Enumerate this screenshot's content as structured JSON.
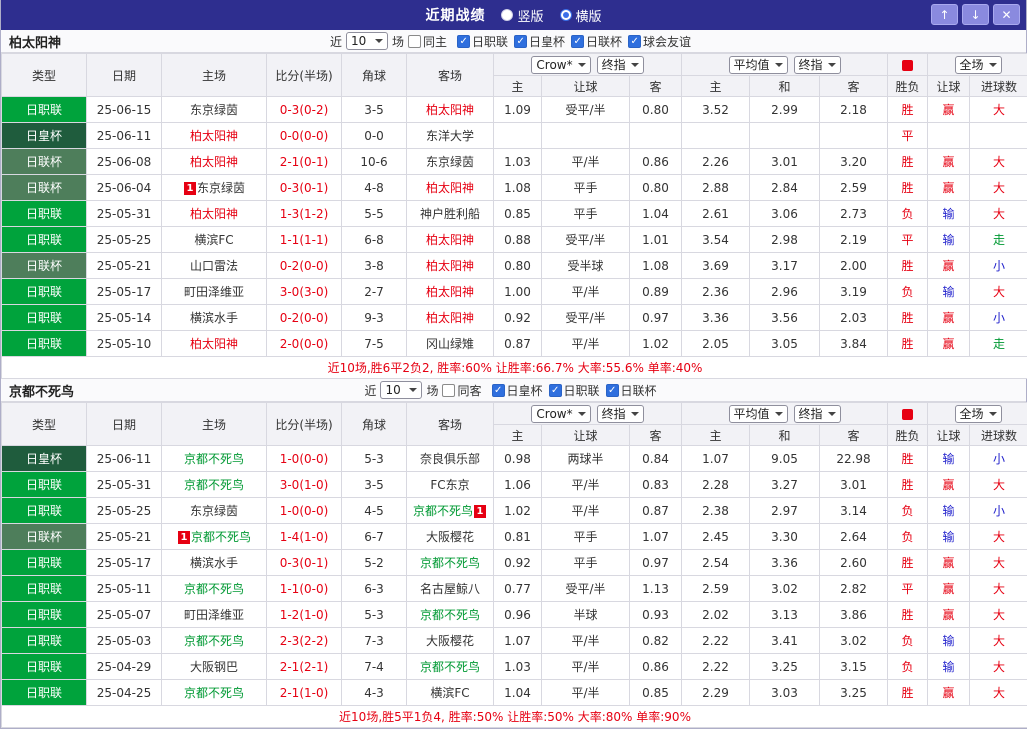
{
  "titlebar": {
    "title": "近期战绩",
    "options": [
      {
        "label": "竖版",
        "selected": false
      },
      {
        "label": "横版",
        "selected": true
      }
    ],
    "buttons": {
      "up": "↑",
      "down": "↓",
      "close": "✕"
    }
  },
  "labels": {
    "near": "近",
    "count": "10",
    "unit": "场"
  },
  "odds_controls": {
    "company": "Crow*",
    "final": "终指",
    "average": "平均值",
    "scope": "全场"
  },
  "table_header": {
    "type": "类型",
    "date": "日期",
    "home": "主场",
    "score": "比分(半场)",
    "corner": "角球",
    "away": "客场",
    "ah_home": "主",
    "ah_line": "让球",
    "ah_away": "客",
    "eu_home": "主",
    "eu_draw": "和",
    "eu_away": "客",
    "result": "胜负",
    "handicap_result": "让球",
    "goals": "进球数"
  },
  "type_colors": {
    "日职联": "#00a33c",
    "日皇杯": "#1f5c3d",
    "日联杯": "#4e7e5b"
  },
  "team_colors": {
    "red": "#e60012",
    "green": "#009933",
    "default": "#333333"
  },
  "palette": {
    "score": "#e60012"
  },
  "value_colors": {
    "胜": "#e60012",
    "平": "#e60012",
    "负": "#e60012",
    "赢": "#e60012",
    "输": "#2222cc",
    "大": "#e60012",
    "小": "#2222cc",
    "走": "#009933"
  },
  "sections": [
    {
      "team": "柏太阳神",
      "same_label": "同主",
      "same_checked": false,
      "competitions": [
        {
          "label": "日职联",
          "checked": true
        },
        {
          "label": "日皇杯",
          "checked": true
        },
        {
          "label": "日联杯",
          "checked": true
        },
        {
          "label": "球会友谊",
          "checked": true
        }
      ],
      "rows": [
        {
          "type": "日职联",
          "date": "25-06-15",
          "home": "东京绿茵",
          "home_color": "default",
          "home_card": "",
          "home_card_pos": "",
          "score": "0-3(0-2)",
          "corner": "3-5",
          "away": "柏太阳神",
          "away_color": "red",
          "away_card": "",
          "away_card_pos": "",
          "odds": [
            "1.09",
            "受平/半",
            "0.80",
            "3.52",
            "2.99",
            "2.18"
          ],
          "result": "胜",
          "rh": "赢",
          "goal": "大"
        },
        {
          "type": "日皇杯",
          "date": "25-06-11",
          "home": "柏太阳神",
          "home_color": "red",
          "home_card": "",
          "home_card_pos": "",
          "score": "0-0(0-0)",
          "corner": "0-0",
          "away": "东洋大学",
          "away_color": "default",
          "away_card": "",
          "away_card_pos": "",
          "odds": [
            "",
            "",
            "",
            "",
            "",
            ""
          ],
          "result": "平",
          "rh": "",
          "goal": ""
        },
        {
          "type": "日联杯",
          "date": "25-06-08",
          "home": "柏太阳神",
          "home_color": "red",
          "home_card": "",
          "home_card_pos": "",
          "score": "2-1(0-1)",
          "corner": "10-6",
          "away": "东京绿茵",
          "away_color": "default",
          "away_card": "",
          "away_card_pos": "",
          "odds": [
            "1.03",
            "平/半",
            "0.86",
            "2.26",
            "3.01",
            "3.20"
          ],
          "result": "胜",
          "rh": "赢",
          "goal": "大"
        },
        {
          "type": "日联杯",
          "date": "25-06-04",
          "home": "东京绿茵",
          "home_color": "default",
          "home_card": "1",
          "home_card_pos": "before",
          "score": "0-3(0-1)",
          "corner": "4-8",
          "away": "柏太阳神",
          "away_color": "red",
          "away_card": "",
          "away_card_pos": "",
          "odds": [
            "1.08",
            "平手",
            "0.80",
            "2.88",
            "2.84",
            "2.59"
          ],
          "result": "胜",
          "rh": "赢",
          "goal": "大"
        },
        {
          "type": "日职联",
          "date": "25-05-31",
          "home": "柏太阳神",
          "home_color": "red",
          "home_card": "",
          "home_card_pos": "",
          "score": "1-3(1-2)",
          "corner": "5-5",
          "away": "神户胜利船",
          "away_color": "default",
          "away_card": "",
          "away_card_pos": "",
          "odds": [
            "0.85",
            "平手",
            "1.04",
            "2.61",
            "3.06",
            "2.73"
          ],
          "result": "负",
          "rh": "输",
          "goal": "大"
        },
        {
          "type": "日职联",
          "date": "25-05-25",
          "home": "横滨FC",
          "home_color": "default",
          "home_card": "",
          "home_card_pos": "",
          "score": "1-1(1-1)",
          "corner": "6-8",
          "away": "柏太阳神",
          "away_color": "red",
          "away_card": "",
          "away_card_pos": "",
          "odds": [
            "0.88",
            "受平/半",
            "1.01",
            "3.54",
            "2.98",
            "2.19"
          ],
          "result": "平",
          "rh": "输",
          "goal": "走"
        },
        {
          "type": "日联杯",
          "date": "25-05-21",
          "home": "山口雷法",
          "home_color": "default",
          "home_card": "",
          "home_card_pos": "",
          "score": "0-2(0-0)",
          "corner": "3-8",
          "away": "柏太阳神",
          "away_color": "red",
          "away_card": "",
          "away_card_pos": "",
          "odds": [
            "0.80",
            "受半球",
            "1.08",
            "3.69",
            "3.17",
            "2.00"
          ],
          "result": "胜",
          "rh": "赢",
          "goal": "小"
        },
        {
          "type": "日职联",
          "date": "25-05-17",
          "home": "町田泽维亚",
          "home_color": "default",
          "home_card": "",
          "home_card_pos": "",
          "score": "3-0(3-0)",
          "corner": "2-7",
          "away": "柏太阳神",
          "away_color": "red",
          "away_card": "",
          "away_card_pos": "",
          "odds": [
            "1.00",
            "平/半",
            "0.89",
            "2.36",
            "2.96",
            "3.19"
          ],
          "result": "负",
          "rh": "输",
          "goal": "大"
        },
        {
          "type": "日职联",
          "date": "25-05-14",
          "home": "横滨水手",
          "home_color": "default",
          "home_card": "",
          "home_card_pos": "",
          "score": "0-2(0-0)",
          "corner": "9-3",
          "away": "柏太阳神",
          "away_color": "red",
          "away_card": "",
          "away_card_pos": "",
          "odds": [
            "0.92",
            "受平/半",
            "0.97",
            "3.36",
            "3.56",
            "2.03"
          ],
          "result": "胜",
          "rh": "赢",
          "goal": "小"
        },
        {
          "type": "日职联",
          "date": "25-05-10",
          "home": "柏太阳神",
          "home_color": "red",
          "home_card": "",
          "home_card_pos": "",
          "score": "2-0(0-0)",
          "corner": "7-5",
          "away": "冈山绿雉",
          "away_color": "default",
          "away_card": "",
          "away_card_pos": "",
          "odds": [
            "0.87",
            "平/半",
            "1.02",
            "2.05",
            "3.05",
            "3.84"
          ],
          "result": "胜",
          "rh": "赢",
          "goal": "走"
        }
      ],
      "summary": "近10场,胜6平2负2, 胜率:60% 让胜率:66.7% 大率:55.6% 单率:40%"
    },
    {
      "team": "京都不死鸟",
      "same_label": "同客",
      "same_checked": false,
      "competitions": [
        {
          "label": "日皇杯",
          "checked": true
        },
        {
          "label": "日职联",
          "checked": true
        },
        {
          "label": "日联杯",
          "checked": true
        }
      ],
      "rows": [
        {
          "type": "日皇杯",
          "date": "25-06-11",
          "home": "京都不死鸟",
          "home_color": "green",
          "home_card": "",
          "home_card_pos": "",
          "score": "1-0(0-0)",
          "corner": "5-3",
          "away": "奈良俱乐部",
          "away_color": "default",
          "away_card": "",
          "away_card_pos": "",
          "odds": [
            "0.98",
            "两球半",
            "0.84",
            "1.07",
            "9.05",
            "22.98"
          ],
          "result": "胜",
          "rh": "输",
          "goal": "小"
        },
        {
          "type": "日职联",
          "date": "25-05-31",
          "home": "京都不死鸟",
          "home_color": "green",
          "home_card": "",
          "home_card_pos": "",
          "score": "3-0(1-0)",
          "corner": "3-5",
          "away": "FC东京",
          "away_color": "default",
          "away_card": "",
          "away_card_pos": "",
          "odds": [
            "1.06",
            "平/半",
            "0.83",
            "2.28",
            "3.27",
            "3.01"
          ],
          "result": "胜",
          "rh": "赢",
          "goal": "大"
        },
        {
          "type": "日职联",
          "date": "25-05-25",
          "home": "东京绿茵",
          "home_color": "default",
          "home_card": "",
          "home_card_pos": "",
          "score": "1-0(0-0)",
          "corner": "4-5",
          "away": "京都不死鸟",
          "away_color": "green",
          "away_card": "1",
          "away_card_pos": "after",
          "odds": [
            "1.02",
            "平/半",
            "0.87",
            "2.38",
            "2.97",
            "3.14"
          ],
          "result": "负",
          "rh": "输",
          "goal": "小"
        },
        {
          "type": "日联杯",
          "date": "25-05-21",
          "home": "京都不死鸟",
          "home_color": "green",
          "home_card": "1",
          "home_card_pos": "before",
          "score": "1-4(1-0)",
          "corner": "6-7",
          "away": "大阪樱花",
          "away_color": "default",
          "away_card": "",
          "away_card_pos": "",
          "odds": [
            "0.81",
            "平手",
            "1.07",
            "2.45",
            "3.30",
            "2.64"
          ],
          "result": "负",
          "rh": "输",
          "goal": "大"
        },
        {
          "type": "日职联",
          "date": "25-05-17",
          "home": "横滨水手",
          "home_color": "default",
          "home_card": "",
          "home_card_pos": "",
          "score": "0-3(0-1)",
          "corner": "5-2",
          "away": "京都不死鸟",
          "away_color": "green",
          "away_card": "",
          "away_card_pos": "",
          "odds": [
            "0.92",
            "平手",
            "0.97",
            "2.54",
            "3.36",
            "2.60"
          ],
          "result": "胜",
          "rh": "赢",
          "goal": "大"
        },
        {
          "type": "日职联",
          "date": "25-05-11",
          "home": "京都不死鸟",
          "home_color": "green",
          "home_card": "",
          "home_card_pos": "",
          "score": "1-1(0-0)",
          "corner": "6-3",
          "away": "名古屋鲸八",
          "away_color": "default",
          "away_card": "",
          "away_card_pos": "",
          "odds": [
            "0.77",
            "受平/半",
            "1.13",
            "2.59",
            "3.02",
            "2.82"
          ],
          "result": "平",
          "rh": "赢",
          "goal": "大"
        },
        {
          "type": "日职联",
          "date": "25-05-07",
          "home": "町田泽维亚",
          "home_color": "default",
          "home_card": "",
          "home_card_pos": "",
          "score": "1-2(1-0)",
          "corner": "5-3",
          "away": "京都不死鸟",
          "away_color": "green",
          "away_card": "",
          "away_card_pos": "",
          "odds": [
            "0.96",
            "半球",
            "0.93",
            "2.02",
            "3.13",
            "3.86"
          ],
          "result": "胜",
          "rh": "赢",
          "goal": "大"
        },
        {
          "type": "日职联",
          "date": "25-05-03",
          "home": "京都不死鸟",
          "home_color": "green",
          "home_card": "",
          "home_card_pos": "",
          "score": "2-3(2-2)",
          "corner": "7-3",
          "away": "大阪樱花",
          "away_color": "default",
          "away_card": "",
          "away_card_pos": "",
          "odds": [
            "1.07",
            "平/半",
            "0.82",
            "2.22",
            "3.41",
            "3.02"
          ],
          "result": "负",
          "rh": "输",
          "goal": "大"
        },
        {
          "type": "日职联",
          "date": "25-04-29",
          "home": "大阪钢巴",
          "home_color": "default",
          "home_card": "",
          "home_card_pos": "",
          "score": "2-1(2-1)",
          "corner": "7-4",
          "away": "京都不死鸟",
          "away_color": "green",
          "away_card": "",
          "away_card_pos": "",
          "odds": [
            "1.03",
            "平/半",
            "0.86",
            "2.22",
            "3.25",
            "3.15"
          ],
          "result": "负",
          "rh": "输",
          "goal": "大"
        },
        {
          "type": "日职联",
          "date": "25-04-25",
          "home": "京都不死鸟",
          "home_color": "green",
          "home_card": "",
          "home_card_pos": "",
          "score": "2-1(1-0)",
          "corner": "4-3",
          "away": "横滨FC",
          "away_color": "default",
          "away_card": "",
          "away_card_pos": "",
          "odds": [
            "1.04",
            "平/半",
            "0.85",
            "2.29",
            "3.03",
            "3.25"
          ],
          "result": "胜",
          "rh": "赢",
          "goal": "大"
        }
      ],
      "summary": "近10场,胜5平1负4, 胜率:50% 让胜率:50% 大率:80% 单率:90%"
    }
  ]
}
